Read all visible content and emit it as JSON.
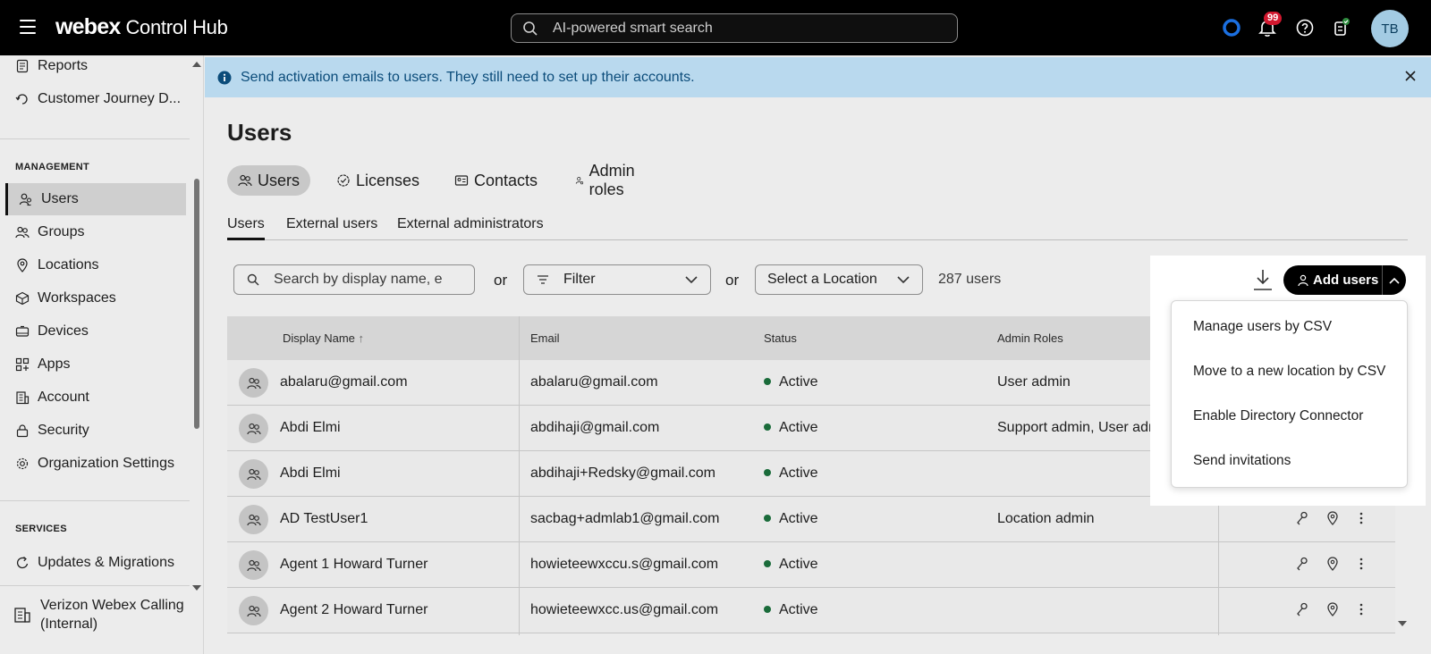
{
  "header": {
    "brand_bold": "webex",
    "brand_rest": "Control Hub",
    "search_placeholder": "AI-powered smart search",
    "notification_count": "99",
    "avatar_initials": "TB"
  },
  "sidebar": {
    "top_items": [
      {
        "label": "Reports",
        "icon": "reports-icon"
      },
      {
        "label": "Customer Journey D...",
        "icon": "journey-icon"
      }
    ],
    "management_title": "MANAGEMENT",
    "management_items": [
      {
        "label": "Users",
        "icon": "users-icon",
        "active": true
      },
      {
        "label": "Groups",
        "icon": "groups-icon"
      },
      {
        "label": "Locations",
        "icon": "location-icon"
      },
      {
        "label": "Workspaces",
        "icon": "workspaces-icon"
      },
      {
        "label": "Devices",
        "icon": "devices-icon"
      },
      {
        "label": "Apps",
        "icon": "apps-icon"
      },
      {
        "label": "Account",
        "icon": "account-icon"
      },
      {
        "label": "Security",
        "icon": "lock-icon"
      },
      {
        "label": "Organization Settings",
        "icon": "gear-icon"
      }
    ],
    "services_title": "SERVICES",
    "services_items": [
      {
        "label": "Updates & Migrations",
        "icon": "refresh-icon"
      }
    ],
    "org_name": "Verizon Webex Calling",
    "org_sub": "(Internal)"
  },
  "banner": {
    "text": "Send activation emails to users. They still need to set up their accounts."
  },
  "page": {
    "title": "Users",
    "pill_tabs": [
      "Users",
      "Licenses",
      "Contacts",
      "Admin roles"
    ],
    "sub_tabs": [
      "Users",
      "External users",
      "External administrators"
    ]
  },
  "toolbar": {
    "search_placeholder": "Search by display name, e",
    "or1": "or",
    "filter_label": "Filter",
    "or2": "or",
    "location_label": "Select a Location",
    "user_count": "287 users",
    "add_users_label": "Add users"
  },
  "add_menu": [
    "Manage users by CSV",
    "Move to a new location by CSV",
    "Enable Directory Connector",
    "Send invitations"
  ],
  "table": {
    "headers": {
      "name": "Display Name",
      "sort": "↑",
      "email": "Email",
      "status": "Status",
      "roles": "Admin Roles"
    },
    "rows": [
      {
        "name": "abalaru@gmail.com",
        "email": "abalaru@gmail.com",
        "status": "Active",
        "roles": "User admin"
      },
      {
        "name": "Abdi Elmi",
        "email": "abdihaji@gmail.com",
        "status": "Active",
        "roles": "Support admin, User admin,"
      },
      {
        "name": "Abdi Elmi",
        "email": "abdihaji+Redsky@gmail.com",
        "status": "Active",
        "roles": ""
      },
      {
        "name": "AD TestUser1",
        "email": "sacbag+admlab1@gmail.com",
        "status": "Active",
        "roles": "Location admin"
      },
      {
        "name": "Agent 1 Howard Turner",
        "email": "howieteewxccu.s@gmail.com",
        "status": "Active",
        "roles": ""
      },
      {
        "name": "Agent 2 Howard Turner",
        "email": "howieteewxcc.us@gmail.com",
        "status": "Active",
        "roles": ""
      }
    ]
  },
  "colors": {
    "active_dot": "#1a6b3a",
    "banner_bg": "#b9d9ee",
    "banner_text": "#0b4c7a",
    "badge": "#d3182f"
  }
}
